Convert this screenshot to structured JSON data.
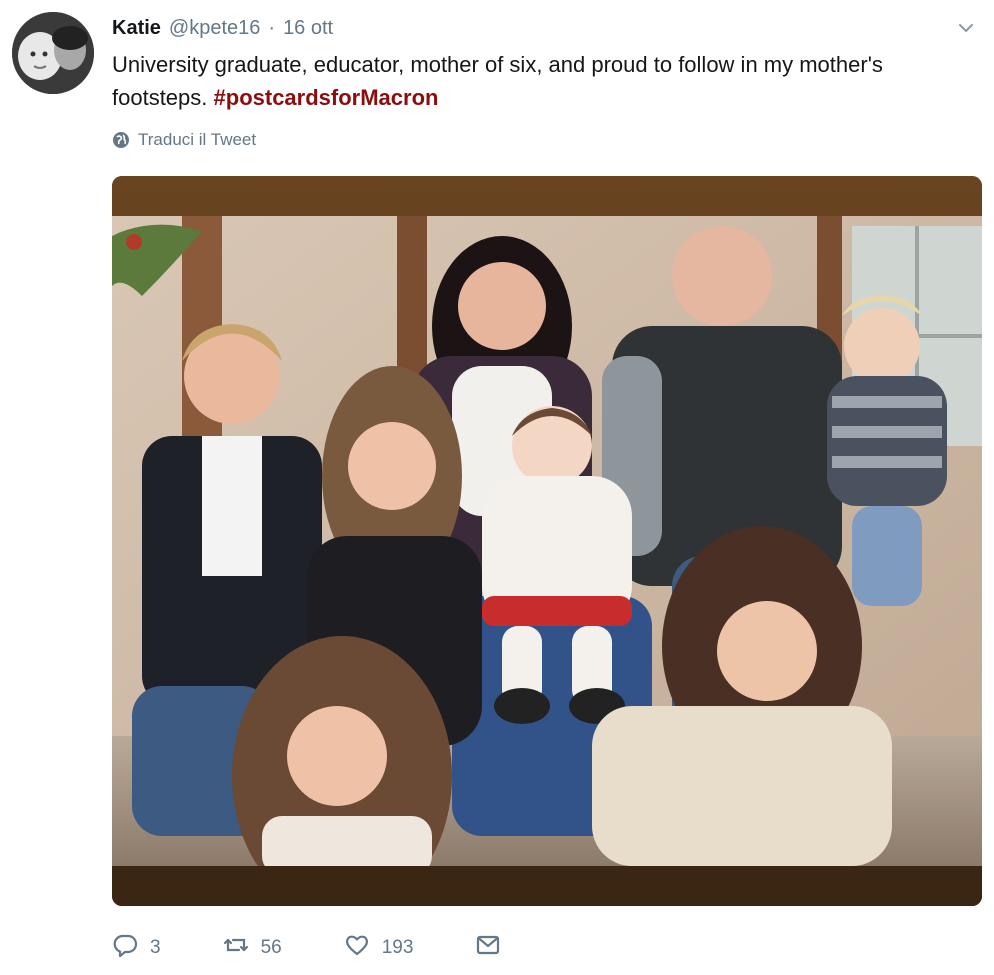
{
  "tweet": {
    "author_name": "Katie",
    "author_handle": "@kpete16",
    "separator": "·",
    "date": "16 ott",
    "text_prefix": "University graduate, educator, mother of six, and proud to follow in my mother's footsteps. ",
    "hashtag": "#postcardsforMacron",
    "translate_label": "Traduci il Tweet"
  },
  "actions": {
    "reply_count": "3",
    "retweet_count": "56",
    "like_count": "193"
  },
  "icons": {
    "avatar": "avatar-photo",
    "menu": "chevron-down-icon",
    "translate": "globe-icon",
    "reply": "reply-icon",
    "retweet": "retweet-icon",
    "like": "heart-icon",
    "dm": "envelope-icon"
  },
  "colors": {
    "text": "#14171a",
    "secondary": "#657786",
    "hashtag": "#8b0d0d"
  }
}
